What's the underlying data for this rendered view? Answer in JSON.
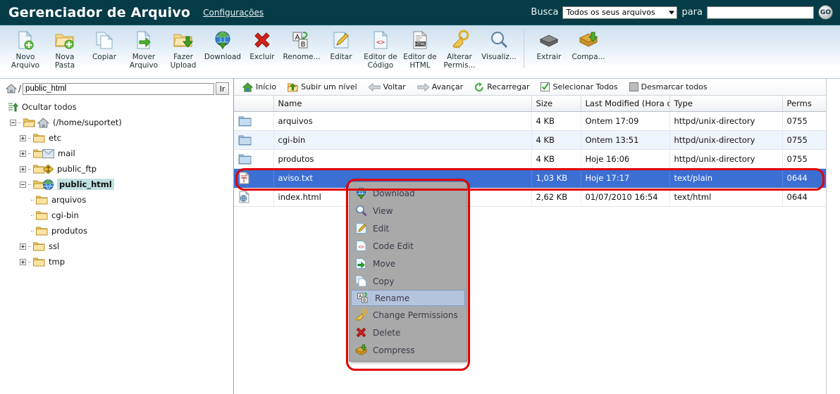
{
  "header": {
    "app_title": "Gerenciador de Arquivo",
    "settings_label": "Configurações",
    "search_label": "Busca",
    "search_scope_value": "Todos os seus arquivos",
    "search_for_label": "para",
    "search_value": "",
    "search_placeholder": "",
    "go_label": "GO"
  },
  "toolbar": {
    "items": [
      {
        "label": "Novo Arquivo",
        "icon": "new-file-icon"
      },
      {
        "label": "Nova Pasta",
        "icon": "new-folder-icon"
      },
      {
        "label": "Copiar",
        "icon": "copy-icon"
      },
      {
        "label": "Mover Arquivo",
        "icon": "move-file-icon"
      },
      {
        "label": "Fazer Upload",
        "icon": "upload-icon"
      },
      {
        "label": "Download",
        "icon": "download-icon"
      },
      {
        "label": "Excluir",
        "icon": "delete-icon"
      },
      {
        "label": "Renome...",
        "icon": "rename-icon"
      },
      {
        "label": "Editar",
        "icon": "edit-icon"
      },
      {
        "label": "Editor de Código",
        "icon": "code-editor-icon"
      },
      {
        "label": "Editor de HTML",
        "icon": "html-editor-icon"
      },
      {
        "label": "Alterar Permis...",
        "icon": "permissions-key-icon"
      },
      {
        "label": "Visualiz...",
        "icon": "view-magnifier-icon"
      },
      {
        "label": "Extrair",
        "icon": "extract-icon"
      },
      {
        "label": "Compa...",
        "icon": "compress-icon"
      }
    ]
  },
  "sidebar": {
    "path_value": "public_html",
    "path_prefix": "/",
    "go_label": "Ir",
    "hide_all_label": "Ocultar todos",
    "tree": [
      {
        "label": "(/home/suportet)",
        "icon": "home-folder-icon",
        "expander": "minus",
        "indent": 0,
        "selected": false
      },
      {
        "label": "etc",
        "icon": "folder-icon",
        "expander": "plus",
        "indent": 1,
        "selected": false
      },
      {
        "label": "mail",
        "icon": "mail-folder-icon",
        "expander": "plus",
        "indent": 1,
        "selected": false
      },
      {
        "label": "public_ftp",
        "icon": "ftp-folder-icon",
        "expander": "plus",
        "indent": 1,
        "selected": false
      },
      {
        "label": "public_html",
        "icon": "web-folder-icon",
        "expander": "minus",
        "indent": 1,
        "selected": true
      },
      {
        "label": "arquivos",
        "icon": "folder-icon",
        "expander": "none",
        "indent": 2,
        "selected": false
      },
      {
        "label": "cgi-bin",
        "icon": "folder-icon",
        "expander": "none",
        "indent": 2,
        "selected": false
      },
      {
        "label": "produtos",
        "icon": "folder-icon",
        "expander": "none",
        "indent": 2,
        "selected": false
      },
      {
        "label": "ssl",
        "icon": "folder-icon",
        "expander": "plus",
        "indent": 1,
        "selected": false
      },
      {
        "label": "tmp",
        "icon": "folder-icon",
        "expander": "plus",
        "indent": 1,
        "selected": false
      }
    ]
  },
  "navbar": {
    "items": [
      {
        "label": "Início",
        "icon": "home-icon"
      },
      {
        "label": "Subir um nível",
        "icon": "up-level-icon"
      },
      {
        "label": "Voltar",
        "icon": "back-arrow-icon"
      },
      {
        "label": "Avançar",
        "icon": "forward-arrow-icon"
      },
      {
        "label": "Recarregar",
        "icon": "reload-icon"
      },
      {
        "label": "Selecionar Todos",
        "icon": "checked-box-icon"
      },
      {
        "label": "Desmarcar todos",
        "icon": "unchecked-box-icon"
      }
    ]
  },
  "filetable": {
    "columns": [
      "",
      "Name",
      "Size",
      "Last Modified (Hora oficia",
      "Type",
      "Perms"
    ],
    "rows": [
      {
        "icon": "folder-icon",
        "name": "arquivos",
        "size": "4 KB",
        "modified": "Ontem 17:09",
        "type": "httpd/unix-directory",
        "perms": "0755",
        "selected": false
      },
      {
        "icon": "folder-icon",
        "name": "cgi-bin",
        "size": "4 KB",
        "modified": "Ontem 13:51",
        "type": "httpd/unix-directory",
        "perms": "0755",
        "selected": false
      },
      {
        "icon": "folder-icon",
        "name": "produtos",
        "size": "4 KB",
        "modified": "Hoje 16:06",
        "type": "httpd/unix-directory",
        "perms": "0755",
        "selected": false
      },
      {
        "icon": "text-file-icon",
        "name": "aviso.txt",
        "size": "1,03 KB",
        "modified": "Hoje 17:17",
        "type": "text/plain",
        "perms": "0644",
        "selected": true
      },
      {
        "icon": "html-file-icon",
        "name": "index.html",
        "size": "2,62 KB",
        "modified": "01/07/2010 16:54",
        "type": "text/html",
        "perms": "0644",
        "selected": false
      }
    ]
  },
  "context_menu": {
    "items": [
      {
        "label": "Download",
        "icon": "download-icon",
        "highlighted": false
      },
      {
        "label": "View",
        "icon": "view-magnifier-icon",
        "highlighted": false
      },
      {
        "label": "Edit",
        "icon": "edit-icon",
        "highlighted": false
      },
      {
        "label": "Code Edit",
        "icon": "code-editor-icon",
        "highlighted": false
      },
      {
        "label": "Move",
        "icon": "move-file-icon",
        "highlighted": false
      },
      {
        "label": "Copy",
        "icon": "copy-icon",
        "highlighted": false
      },
      {
        "label": "Rename",
        "icon": "rename-icon",
        "highlighted": true
      },
      {
        "label": "Change Permissions",
        "icon": "permissions-key-icon",
        "highlighted": false
      },
      {
        "label": "Delete",
        "icon": "delete-icon",
        "highlighted": false
      },
      {
        "label": "Compress",
        "icon": "compress-icon",
        "highlighted": false
      }
    ]
  },
  "colors": {
    "header_bg": "#063c47",
    "selection_blue": "#3b6fd4",
    "menu_gray": "#a9a9a9",
    "annotation_red": "#e00000",
    "tree_selected_bg": "#bfe0e0",
    "alt_row_bg": "#eff5fd"
  },
  "annotations": [
    {
      "name": "highlight-selected-row"
    },
    {
      "name": "highlight-context-menu"
    }
  ]
}
